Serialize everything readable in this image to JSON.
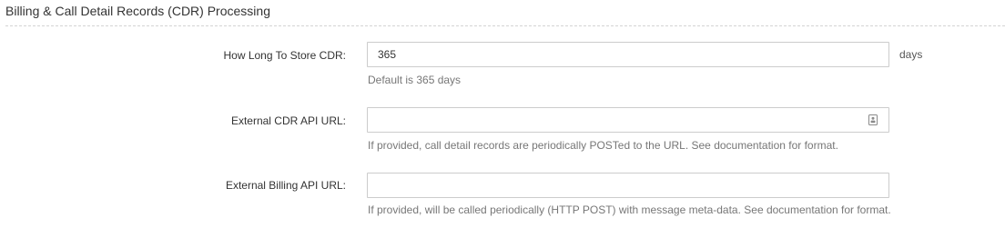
{
  "section": {
    "title": "Billing & Call Detail Records (CDR) Processing"
  },
  "fields": {
    "cdr_retention": {
      "label": "How Long To Store CDR:",
      "value": "365",
      "suffix": "days",
      "help": "Default is 365 days"
    },
    "cdr_api_url": {
      "label": "External CDR API URL:",
      "value": "",
      "icon": "autofill-contact-card-icon",
      "help": "If provided, call detail records are periodically POSTed to the URL. See documentation for format."
    },
    "billing_api_url": {
      "label": "External Billing API URL:",
      "value": "",
      "help": "If provided, will be called periodically (HTTP POST) with message meta-data. See documentation for format."
    }
  }
}
